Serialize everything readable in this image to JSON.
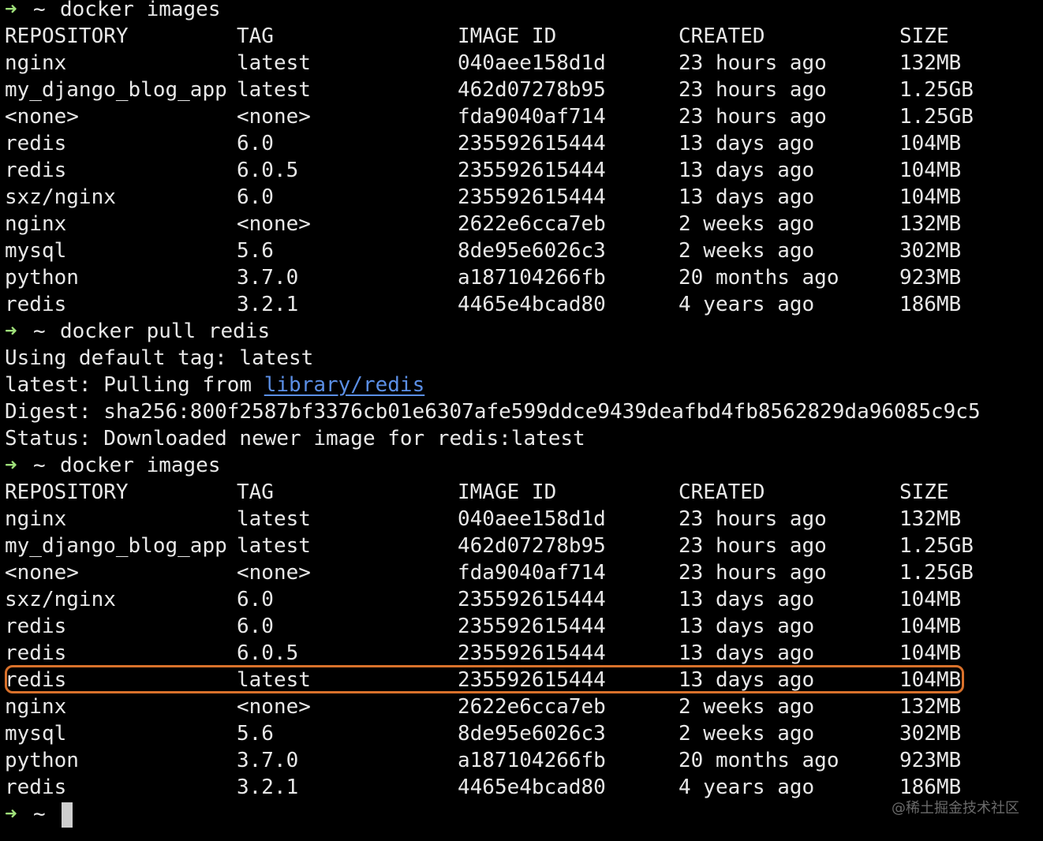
{
  "prompt": {
    "arrow": "➜",
    "tilde": "~"
  },
  "commands": {
    "images1": "docker images",
    "pull": "docker pull redis",
    "images2": "docker images"
  },
  "table_headers": {
    "repository": "REPOSITORY",
    "tag": "TAG",
    "image_id": "IMAGE ID",
    "created": "CREATED",
    "size": "SIZE"
  },
  "images_first": [
    {
      "repo": "nginx",
      "tag": "latest",
      "id": "040aee158d1d",
      "created": "23 hours ago",
      "size": "132MB"
    },
    {
      "repo": "my_django_blog_app",
      "tag": "latest",
      "id": "462d07278b95",
      "created": "23 hours ago",
      "size": "1.25GB"
    },
    {
      "repo": "<none>",
      "tag": "<none>",
      "id": "fda9040af714",
      "created": "23 hours ago",
      "size": "1.25GB"
    },
    {
      "repo": "redis",
      "tag": "6.0",
      "id": "235592615444",
      "created": "13 days ago",
      "size": "104MB"
    },
    {
      "repo": "redis",
      "tag": "6.0.5",
      "id": "235592615444",
      "created": "13 days ago",
      "size": "104MB"
    },
    {
      "repo": "sxz/nginx",
      "tag": "6.0",
      "id": "235592615444",
      "created": "13 days ago",
      "size": "104MB"
    },
    {
      "repo": "nginx",
      "tag": "<none>",
      "id": "2622e6cca7eb",
      "created": "2 weeks ago",
      "size": "132MB"
    },
    {
      "repo": "mysql",
      "tag": "5.6",
      "id": "8de95e6026c3",
      "created": "2 weeks ago",
      "size": "302MB"
    },
    {
      "repo": "python",
      "tag": "3.7.0",
      "id": "a187104266fb",
      "created": "20 months ago",
      "size": "923MB"
    },
    {
      "repo": "redis",
      "tag": "3.2.1",
      "id": "4465e4bcad80",
      "created": "4 years ago",
      "size": "186MB"
    }
  ],
  "pull_output": {
    "line1": "Using default tag: latest",
    "line2_prefix": "latest: Pulling from ",
    "line2_link": "library/redis",
    "line3": "Digest: sha256:800f2587bf3376cb01e6307afe599ddce9439deafbd4fb8562829da96085c9c5",
    "line4": "Status: Downloaded newer image for redis:latest"
  },
  "images_second": [
    {
      "repo": "nginx",
      "tag": "latest",
      "id": "040aee158d1d",
      "created": "23 hours ago",
      "size": "132MB"
    },
    {
      "repo": "my_django_blog_app",
      "tag": "latest",
      "id": "462d07278b95",
      "created": "23 hours ago",
      "size": "1.25GB"
    },
    {
      "repo": "<none>",
      "tag": "<none>",
      "id": "fda9040af714",
      "created": "23 hours ago",
      "size": "1.25GB"
    },
    {
      "repo": "sxz/nginx",
      "tag": "6.0",
      "id": "235592615444",
      "created": "13 days ago",
      "size": "104MB"
    },
    {
      "repo": "redis",
      "tag": "6.0",
      "id": "235592615444",
      "created": "13 days ago",
      "size": "104MB"
    },
    {
      "repo": "redis",
      "tag": "6.0.5",
      "id": "235592615444",
      "created": "13 days ago",
      "size": "104MB"
    },
    {
      "repo": "redis",
      "tag": "latest",
      "id": "235592615444",
      "created": "13 days ago",
      "size": "104MB"
    },
    {
      "repo": "nginx",
      "tag": "<none>",
      "id": "2622e6cca7eb",
      "created": "2 weeks ago",
      "size": "132MB"
    },
    {
      "repo": "mysql",
      "tag": "5.6",
      "id": "8de95e6026c3",
      "created": "2 weeks ago",
      "size": "302MB"
    },
    {
      "repo": "python",
      "tag": "3.7.0",
      "id": "a187104266fb",
      "created": "20 months ago",
      "size": "923MB"
    },
    {
      "repo": "redis",
      "tag": "3.2.1",
      "id": "4465e4bcad80",
      "created": "4 years ago",
      "size": "186MB"
    }
  ],
  "highlight_color": "#d9712b",
  "prompt_color": "#9fe07a",
  "link_color": "#5b8fe6",
  "watermark": "@稀土掘金技术社区"
}
